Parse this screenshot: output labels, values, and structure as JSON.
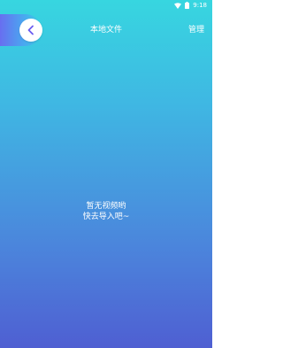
{
  "status_bar": {
    "time": "9:18",
    "icons": [
      "wifi-icon",
      "battery-icon"
    ]
  },
  "header": {
    "title": "本地文件",
    "manage_label": "管理",
    "back_icon": "chevron-left-icon"
  },
  "empty_state": {
    "line1": "暂无视频哟",
    "line2": "快去导入吧~"
  },
  "colors": {
    "gradient_top": "#37d6e0",
    "gradient_bottom": "#4f5fd2",
    "text": "#ffffff",
    "back_icon": "#6b5cf0"
  }
}
